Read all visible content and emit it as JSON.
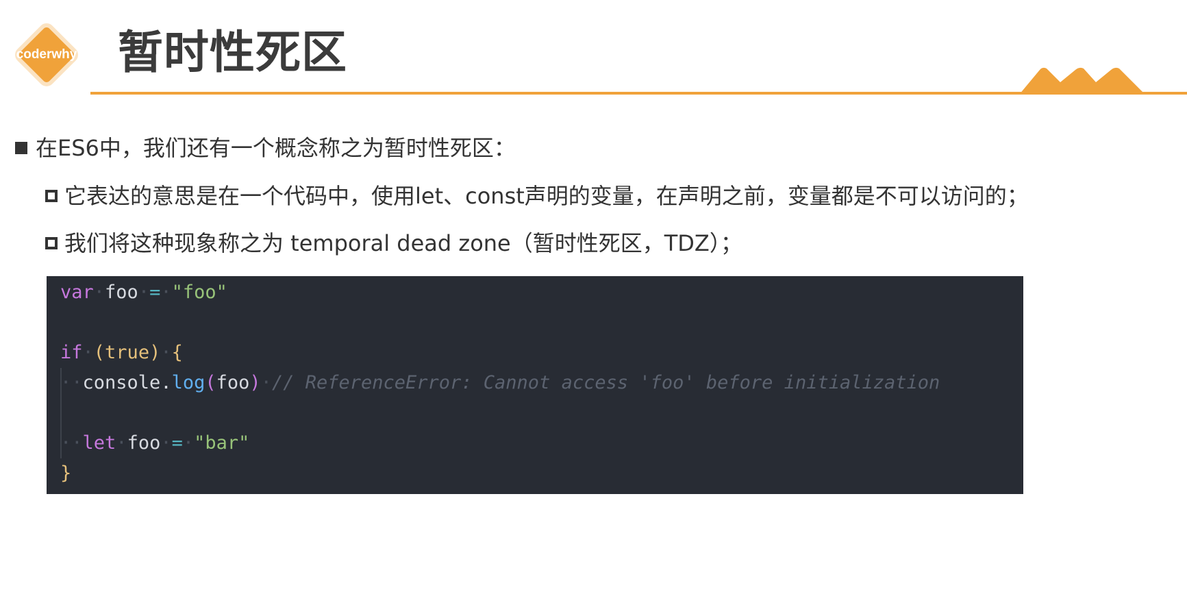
{
  "header": {
    "logo_text": "coderwhy",
    "title": "暂时性死区"
  },
  "colors": {
    "accent": "#f0a23a",
    "code_background": "#282c34"
  },
  "bullets": {
    "main": "在ES6中，我们还有一个概念称之为暂时性死区：",
    "sub": [
      "它表达的意思是在一个代码中，使用let、const声明的变量，在声明之前，变量都是不可以访问的；",
      "我们将这种现象称之为 temporal dead zone（暂时性死区，TDZ）；"
    ]
  },
  "code": {
    "line1": {
      "kw": "var",
      "name": "foo",
      "op": "=",
      "value": "\"foo\""
    },
    "line3": {
      "kw": "if",
      "open": "(",
      "cond": "true",
      "close": ")",
      "brace": "{"
    },
    "line4": {
      "obj": "console",
      "dot": ".",
      "method": "log",
      "open": "(",
      "arg": "foo",
      "close": ")",
      "comment": "// ReferenceError: Cannot access 'foo' before initialization"
    },
    "line6": {
      "kw": "let",
      "name": "foo",
      "op": "=",
      "value": "\"bar\""
    },
    "line7": {
      "brace": "}"
    }
  }
}
